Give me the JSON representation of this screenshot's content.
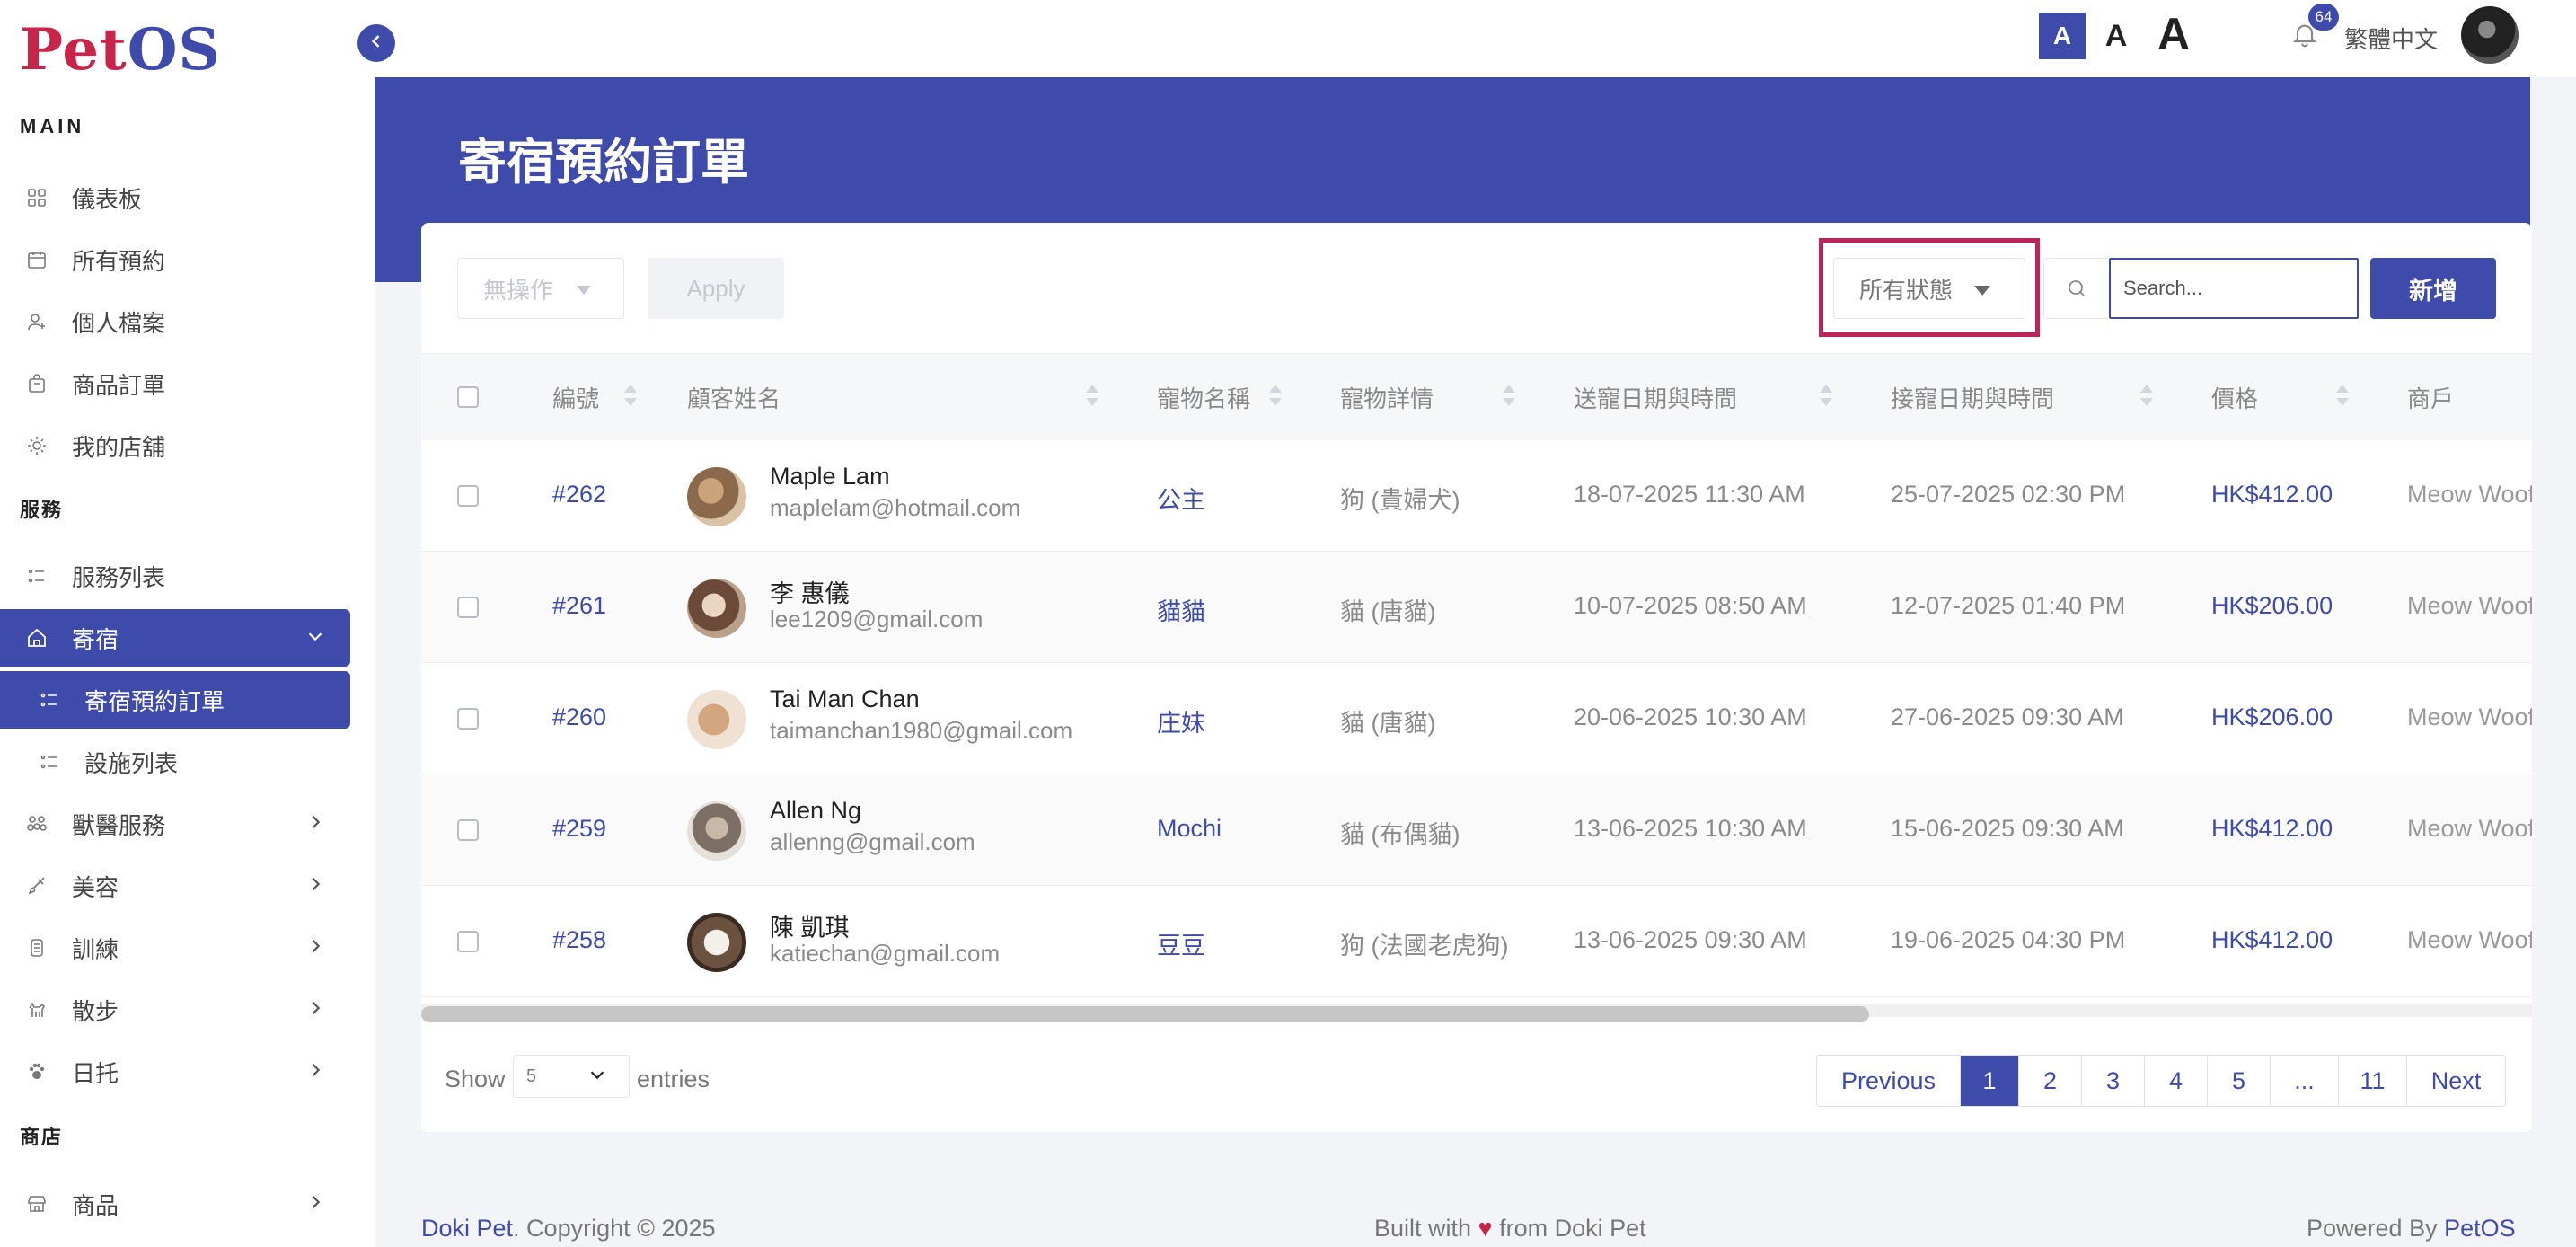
{
  "app": {
    "logo_part1": "Pet",
    "logo_part2": "OS"
  },
  "sidebar": {
    "section_main": "MAIN",
    "section_services": "服務",
    "section_shop": "商店",
    "items": [
      {
        "label": "儀表板",
        "icon": "dashboard-icon"
      },
      {
        "label": "所有預約",
        "icon": "calendar-icon"
      },
      {
        "label": "個人檔案",
        "icon": "user-icon"
      },
      {
        "label": "商品訂單",
        "icon": "bag-icon"
      },
      {
        "label": "我的店舖",
        "icon": "store-icon"
      },
      {
        "label": "服務列表",
        "icon": "list-icon"
      },
      {
        "label": "寄宿",
        "icon": "home-icon"
      },
      {
        "label": "寄宿預約訂單",
        "icon": "list-icon"
      },
      {
        "label": "設施列表",
        "icon": "list-icon"
      },
      {
        "label": "獸醫服務",
        "icon": "vet-icon"
      },
      {
        "label": "美容",
        "icon": "brush-icon"
      },
      {
        "label": "訓練",
        "icon": "training-icon"
      },
      {
        "label": "散步",
        "icon": "dog-walk-icon"
      },
      {
        "label": "日托",
        "icon": "paw-icon"
      },
      {
        "label": "商品",
        "icon": "shop-icon"
      }
    ]
  },
  "topbar": {
    "font_small": "A",
    "font_medium": "A",
    "font_large": "A",
    "notification_count": "64",
    "language": "繁體中文"
  },
  "page": {
    "title": "寄宿預約訂單"
  },
  "toolbar": {
    "bulk_action": "無操作",
    "apply_label": "Apply",
    "status_filter": "所有狀態",
    "search_placeholder": "Search...",
    "add_label": "新增"
  },
  "table": {
    "columns": [
      "編號",
      "顧客姓名",
      "寵物名稱",
      "寵物詳情",
      "送寵日期與時間",
      "接寵日期與時間",
      "價格",
      "商戶"
    ],
    "rows": [
      {
        "id": "#262",
        "name": "Maple Lam",
        "email": "maplelam@hotmail.com",
        "pet": "公主",
        "detail": "狗 (貴婦犬)",
        "dropoff": "18-07-2025 11:30 AM",
        "pickup": "25-07-2025 02:30 PM",
        "price": "HK$412.00",
        "merchant": "Meow Woof"
      },
      {
        "id": "#261",
        "name": "李 惠儀",
        "email": "lee1209@gmail.com",
        "pet": "貓貓",
        "detail": "貓 (唐貓)",
        "dropoff": "10-07-2025 08:50 AM",
        "pickup": "12-07-2025 01:40 PM",
        "price": "HK$206.00",
        "merchant": "Meow Woof"
      },
      {
        "id": "#260",
        "name": "Tai Man Chan",
        "email": "taimanchan1980@gmail.com",
        "pet": "庄妹",
        "detail": "貓 (唐貓)",
        "dropoff": "20-06-2025 10:30 AM",
        "pickup": "27-06-2025 09:30 AM",
        "price": "HK$206.00",
        "merchant": "Meow Woof"
      },
      {
        "id": "#259",
        "name": "Allen Ng",
        "email": "allenng@gmail.com",
        "pet": "Mochi",
        "detail": "貓 (布偶貓)",
        "dropoff": "13-06-2025 10:30 AM",
        "pickup": "15-06-2025 09:30 AM",
        "price": "HK$412.00",
        "merchant": "Meow Woof"
      },
      {
        "id": "#258",
        "name": "陳 凱琪",
        "email": "katiechan@gmail.com",
        "pet": "豆豆",
        "detail": "狗 (法國老虎狗)",
        "dropoff": "13-06-2025 09:30 AM",
        "pickup": "19-06-2025 04:30 PM",
        "price": "HK$412.00",
        "merchant": "Meow Woof"
      }
    ]
  },
  "pagination": {
    "show_label": "Show",
    "entries_value": "5",
    "entries_label": "entries",
    "prev": "Previous",
    "pages": [
      "1",
      "2",
      "3",
      "4",
      "5",
      "...",
      "11"
    ],
    "next": "Next",
    "current": "1"
  },
  "footer": {
    "brand": "Doki Pet",
    "copyright": ". Copyright © 2025",
    "built_prefix": "Built with ",
    "heart": "♥",
    "built_suffix": " from Doki Pet",
    "powered_prefix": "Powered By ",
    "powered_brand": "PetOS"
  },
  "colors": {
    "primary": "#3f4bab",
    "brand_red": "#c8254a",
    "highlight": "#c2215a"
  }
}
